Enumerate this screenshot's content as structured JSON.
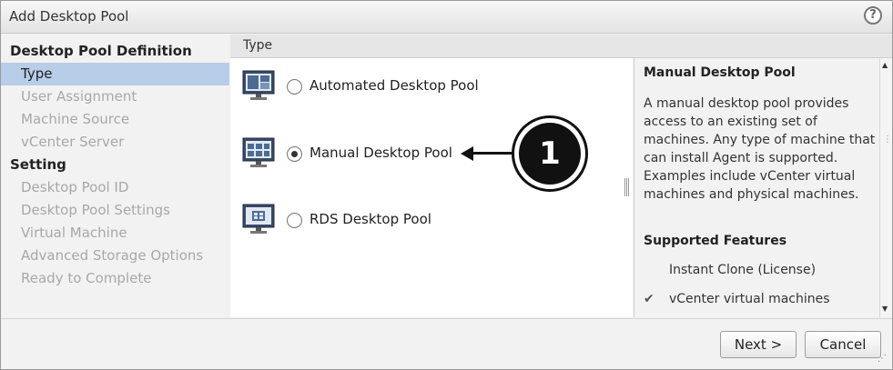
{
  "window": {
    "title": "Add Desktop Pool",
    "help_glyph": "?"
  },
  "nav": {
    "section_definition": "Desktop Pool Definition",
    "section_setting": "Setting",
    "items": [
      {
        "label": "Type",
        "selected": true
      },
      {
        "label": "User Assignment"
      },
      {
        "label": "Machine Source"
      },
      {
        "label": "vCenter Server"
      },
      {
        "label": "Desktop Pool ID"
      },
      {
        "label": "Desktop Pool Settings"
      },
      {
        "label": "Virtual Machine"
      },
      {
        "label": "Advanced Storage Options"
      },
      {
        "label": "Ready to Complete"
      }
    ]
  },
  "main": {
    "header": "Type",
    "options": [
      {
        "label": "Automated Desktop Pool",
        "icon": "automated-pool-icon",
        "checked": false
      },
      {
        "label": "Manual Desktop Pool",
        "icon": "manual-pool-icon",
        "checked": true
      },
      {
        "label": "RDS Desktop Pool",
        "icon": "rds-pool-icon",
        "checked": false
      }
    ]
  },
  "description": {
    "title": "Manual Desktop Pool",
    "body": "A manual desktop pool provides access to an existing set of machines. Any type of machine that can install Agent is supported. Examples include vCenter virtual machines and physical machines.",
    "features_heading": "Supported Features",
    "features": [
      {
        "label": "Instant Clone (License)",
        "checked": false
      },
      {
        "label": "vCenter virtual machines",
        "checked": true
      }
    ],
    "check_glyph": "✔"
  },
  "footer": {
    "next_label": "Next >",
    "cancel_label": "Cancel"
  },
  "annotation": {
    "number": "1"
  },
  "colors": {
    "selected_bg": "#b7cde8",
    "disabled_text": "#a8a8a8",
    "panel_bg": "#f2f2f2"
  }
}
